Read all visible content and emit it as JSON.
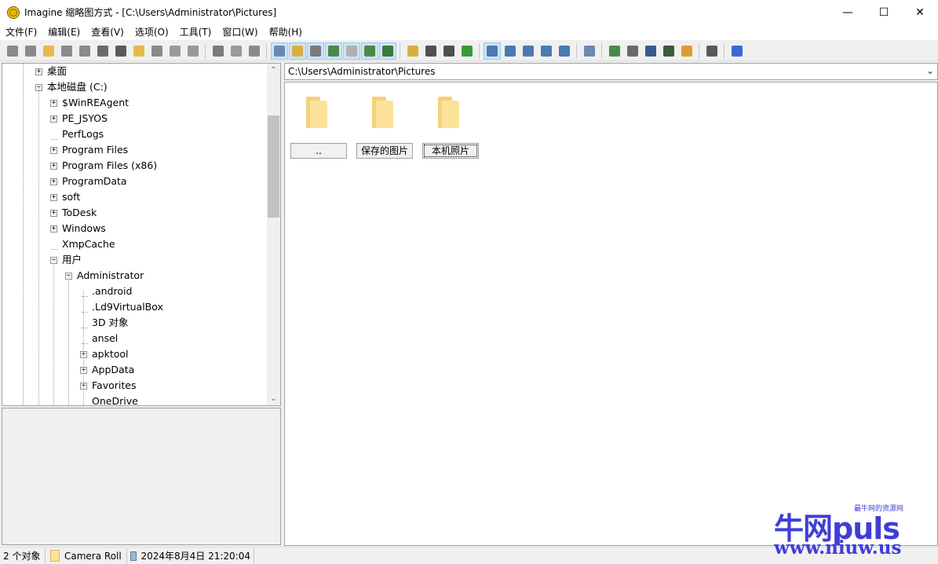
{
  "window": {
    "title": "Imagine 缩略图方式 - [C:\\Users\\Administrator\\Pictures]",
    "minimize": "—",
    "maximize": "☐",
    "close": "✕"
  },
  "menu": [
    "文件(F)",
    "编辑(E)",
    "查看(V)",
    "选项(O)",
    "工具(T)",
    "窗口(W)",
    "帮助(H)"
  ],
  "toolbar": {
    "groups": [
      [
        {
          "icon": "eye-icon",
          "color": "#8a8a8a"
        },
        {
          "icon": "slideshow-icon",
          "color": "#8a8a8a"
        },
        {
          "icon": "open-folder-icon",
          "color": "#e8b84a"
        },
        {
          "icon": "save-icon",
          "color": "#8a8a8a"
        },
        {
          "icon": "print-icon",
          "color": "#8a8a8a"
        },
        {
          "icon": "info-icon",
          "color": "#6a6a6a"
        },
        {
          "icon": "camera-icon",
          "color": "#5a5a5a"
        },
        {
          "icon": "new-folder-icon",
          "color": "#e8b84a"
        },
        {
          "icon": "rename-icon",
          "color": "#8a8a8a"
        },
        {
          "icon": "trash-icon",
          "color": "#9a9a9a"
        },
        {
          "icon": "settings-icon",
          "color": "#9a9a9a"
        }
      ],
      [
        {
          "icon": "cut-icon",
          "color": "#7a7a7a"
        },
        {
          "icon": "copy-icon",
          "color": "#9a9a9a"
        },
        {
          "icon": "paste-icon",
          "color": "#8a8a8a"
        }
      ],
      [
        {
          "icon": "filmstrip-icon",
          "color": "#6a8ab0",
          "pressed": true
        },
        {
          "icon": "tree-icon",
          "color": "#d8b040",
          "pressed": true
        },
        {
          "icon": "clock-icon",
          "color": "#7a7a7a",
          "pressed": true
        },
        {
          "icon": "preview-icon",
          "color": "#4a8a4a",
          "pressed": true
        },
        {
          "icon": "grid-icon",
          "color": "#b0b0b0",
          "pressed": true
        },
        {
          "icon": "panel-icon",
          "color": "#4a8a4a",
          "pressed": true
        },
        {
          "icon": "thumbnail-icon",
          "color": "#3a7a3a",
          "pressed": true
        }
      ],
      [
        {
          "icon": "up-folder-icon",
          "color": "#d8b040"
        },
        {
          "icon": "back-icon",
          "color": "#505050"
        },
        {
          "icon": "forward-icon",
          "color": "#505050"
        },
        {
          "icon": "refresh-icon",
          "color": "#3a9a3a"
        }
      ],
      [
        {
          "icon": "view-large-icon",
          "color": "#4a7ab0",
          "pressed": true
        },
        {
          "icon": "view-medium-icon",
          "color": "#4a7ab0"
        },
        {
          "icon": "view-small-icon",
          "color": "#4a7ab0"
        },
        {
          "icon": "view-list-icon",
          "color": "#4a7ab0"
        },
        {
          "icon": "view-details-icon",
          "color": "#4a7ab0"
        }
      ],
      [
        {
          "icon": "wrench-icon",
          "color": "#6a8ab0"
        }
      ],
      [
        {
          "icon": "batch-convert-icon",
          "color": "#4a8a4a"
        },
        {
          "icon": "batch-rename-icon",
          "color": "#6a6a6a"
        },
        {
          "icon": "capture-icon",
          "color": "#3a5a8a"
        },
        {
          "icon": "film-icon",
          "color": "#3a5a3a"
        },
        {
          "icon": "edit-icon",
          "color": "#d8a030"
        }
      ],
      [
        {
          "icon": "pen-icon",
          "color": "#5a5a5a"
        }
      ],
      [
        {
          "icon": "help-icon",
          "color": "#3a6ad8"
        }
      ]
    ]
  },
  "tree": {
    "items": [
      {
        "label": "桌面",
        "level": 2,
        "expander": "+"
      },
      {
        "label": "本地磁盘 (C:)",
        "level": 2,
        "expander": "-"
      },
      {
        "label": "$WinREAgent",
        "level": 3,
        "expander": "+"
      },
      {
        "label": "PE_JSYOS",
        "level": 3,
        "expander": "+"
      },
      {
        "label": "PerfLogs",
        "level": 3,
        "expander": ""
      },
      {
        "label": "Program Files",
        "level": 3,
        "expander": "+"
      },
      {
        "label": "Program Files (x86)",
        "level": 3,
        "expander": "+"
      },
      {
        "label": "ProgramData",
        "level": 3,
        "expander": "+"
      },
      {
        "label": "soft",
        "level": 3,
        "expander": "+"
      },
      {
        "label": "ToDesk",
        "level": 3,
        "expander": "+"
      },
      {
        "label": "Windows",
        "level": 3,
        "expander": "+"
      },
      {
        "label": "XmpCache",
        "level": 3,
        "expander": ""
      },
      {
        "label": "用户",
        "level": 3,
        "expander": "-"
      },
      {
        "label": "Administrator",
        "level": 4,
        "expander": "-"
      },
      {
        "label": ".android",
        "level": 5,
        "expander": ""
      },
      {
        "label": ".Ld9VirtualBox",
        "level": 5,
        "expander": ""
      },
      {
        "label": "3D 对象",
        "level": 5,
        "expander": ""
      },
      {
        "label": "ansel",
        "level": 5,
        "expander": ""
      },
      {
        "label": "apktool",
        "level": 5,
        "expander": "+"
      },
      {
        "label": "AppData",
        "level": 5,
        "expander": "+"
      },
      {
        "label": "Favorites",
        "level": 5,
        "expander": "+"
      },
      {
        "label": "OneDrive",
        "level": 5,
        "expander": ""
      }
    ]
  },
  "path": {
    "value": "C:\\Users\\Administrator\\Pictures"
  },
  "files": [
    {
      "label": ".."
    },
    {
      "label": "保存的图片"
    },
    {
      "label": "本机照片",
      "focused": true
    }
  ],
  "status": {
    "count": "2 个对象",
    "folder": "Camera Roll",
    "datetime": "2024年8月4日 21:20:04"
  },
  "watermark": {
    "brand": "牛网puls",
    "tagline": "最牛网的资源网",
    "url": "www.niuw.us"
  }
}
